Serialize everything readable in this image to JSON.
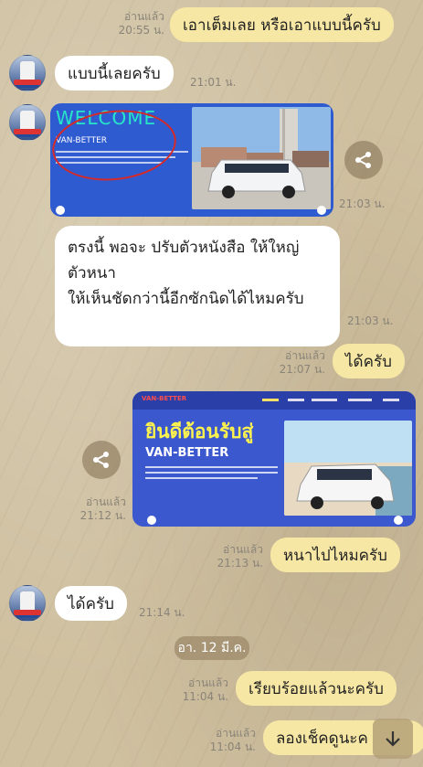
{
  "messages": {
    "m1": {
      "text": "เอาเต็มเลย หรือเอาแบบนี้ครับ",
      "read": "อ่านแล้ว",
      "time": "20:55 น."
    },
    "m2": {
      "text": "แบบนี้เลยครับ",
      "time": "21:01 น."
    },
    "m3": {
      "time": "21:03 น.",
      "welcome": "WELCOME",
      "brand": "VAN-BETTER"
    },
    "m4": {
      "line1": "ตรงนี้ พอจะ ปรับตัวหนังสือ ให้ใหญ่",
      "line2": "ตัวหนา",
      "line3": "ให้เห็นชัดกว่านี้อีกซักนิดได้ไหมครับ",
      "time": "21:03 น."
    },
    "m5": {
      "text": "ได้ครับ",
      "read": "อ่านแล้ว",
      "time": "21:07 น."
    },
    "m6": {
      "read": "อ่านแล้ว",
      "time": "21:12 น.",
      "logo": "VAN-BETTER",
      "headline": "ยินดีต้อนรับสู่",
      "brand": "VAN-BETTER"
    },
    "m7": {
      "text": "หนาไปไหมครับ",
      "read": "อ่านแล้ว",
      "time": "21:13 น."
    },
    "m8": {
      "text": "ได้ครับ",
      "time": "21:14 น."
    },
    "m9": {
      "text": "เรียบร้อยแล้วนะครับ",
      "read": "อ่านแล้ว",
      "time": "11:04 น."
    },
    "m10": {
      "text": "ลองเช็คดูนะค",
      "read": "อ่านแล้ว",
      "time": "11:04 น."
    }
  },
  "date_chip": "อา. 12 มี.ค.",
  "colors": {
    "outgoing": "#f7e7a4",
    "incoming": "#ffffff",
    "accent": "#3a59d8"
  },
  "icons": {
    "share": "share-icon",
    "scroll": "arrow-down-icon"
  }
}
